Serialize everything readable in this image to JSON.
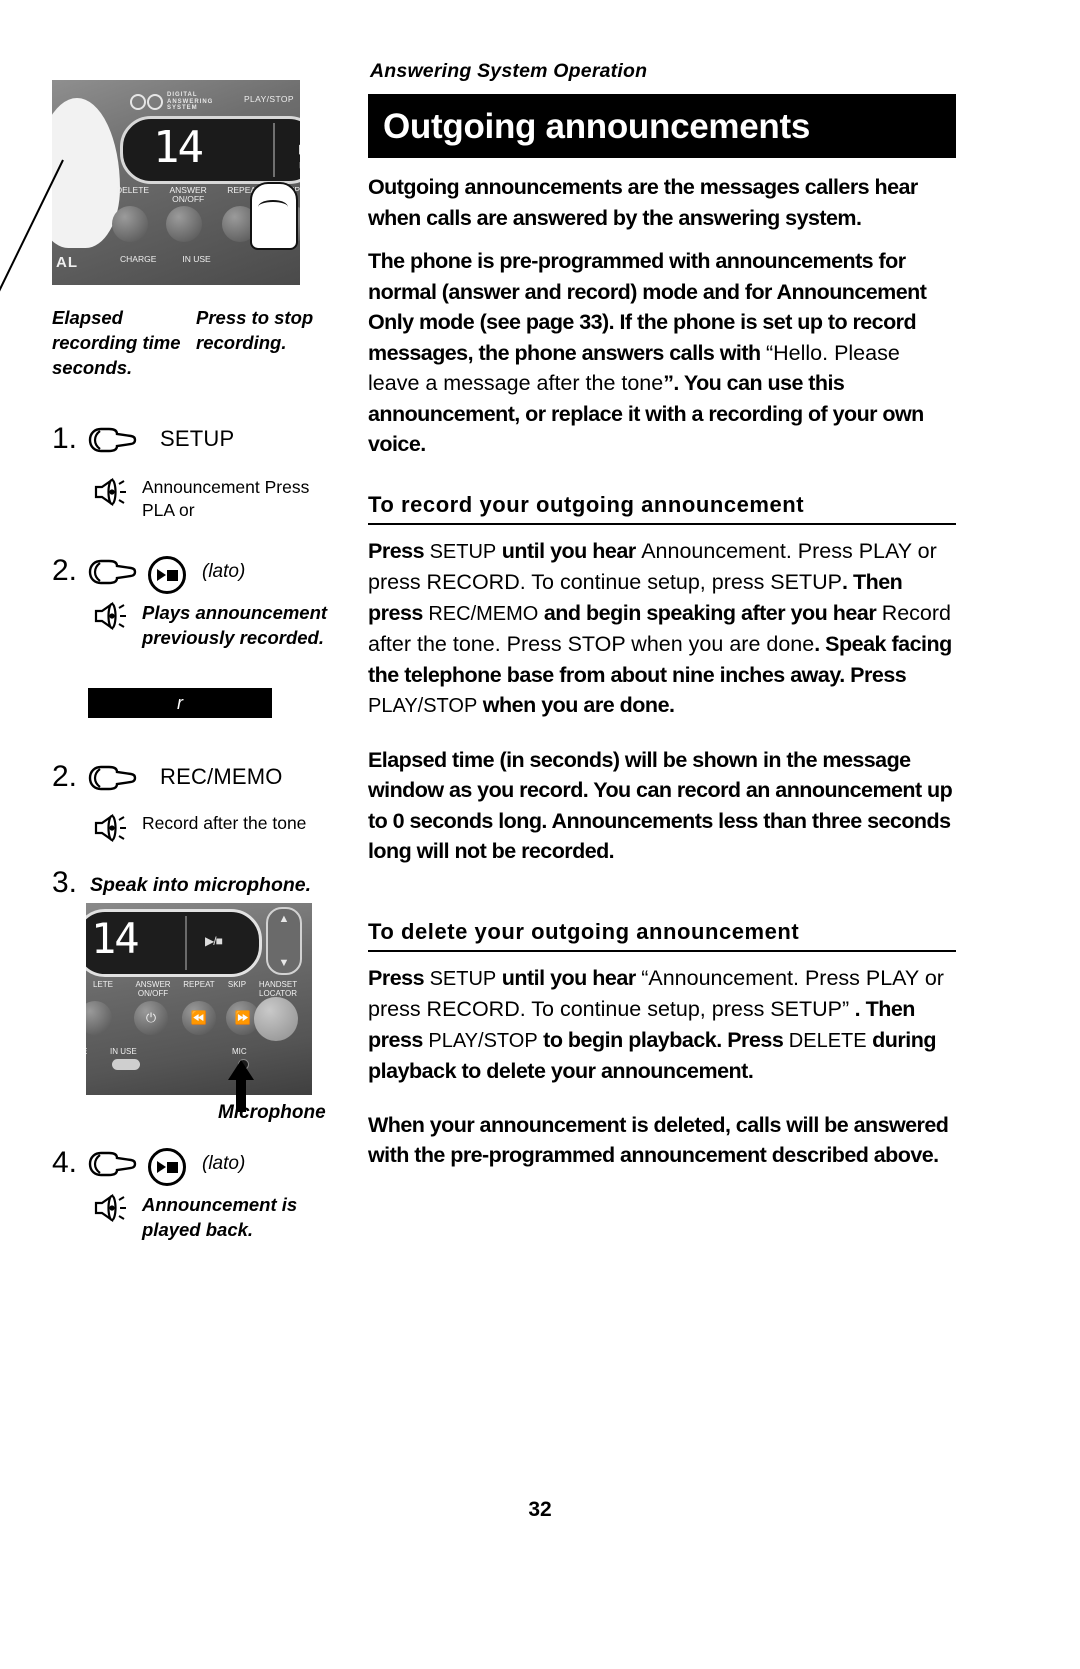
{
  "running_head": "Answering System Operation",
  "banner_title": "Outgoing announcements",
  "page_number": "32",
  "intro": {
    "p1": "Outgoing announcements are the messages callers hear when calls are answered by the answering system.",
    "p2_a": "The phone is pre-programmed with announcements for normal (answer and record) mode and for Announcement Only mode (see page 33). If the phone is set up to record messages, the phone answers calls with ",
    "p2_quote": "“Hello. Please leave a message after the tone",
    "p2_close": "”.",
    "p2_b": " You can use this announcement, or replace it with a recording of your own voice."
  },
  "record_section": {
    "heading": "To record your outgoing announcement",
    "line1_bold": "Press",
    "line1_key": "SETUP",
    "line1_bold2": "until you hear",
    "line1_reg": "Announcement. Press PLAY or press RECORD. To continue setup, press SETUP",
    "line2_bold": ". Then press",
    "line2_key": "REC/MEMO",
    "line2_bold2": "and begin speaking after you hear",
    "line2_reg": "Record after the tone. Press STOP when you are done",
    "line3_bold": ". Speak facing the telephone base from about nine inches away. Press",
    "line3_key": "PLAY/STOP",
    "line3_bold2": "when you are done.",
    "p_elapsed": "Elapsed time (in seconds) will be shown in the message window as you record. You can record an announcement up to 0 seconds long. Announcements less than three seconds long will not be recorded."
  },
  "delete_section": {
    "heading": "To delete your outgoing announcement",
    "line1_bold": "Press",
    "line1_key": "SETUP",
    "line1_bold2": "until you hear",
    "line1_reg": "“Announcement. Press PLAY or press RECORD. To continue setup, press SETUP”",
    "line2_bold": ". Then press",
    "line2_key": "PLAY/STOP",
    "line2_bold2": "to begin playback.",
    "line3_bold": "Press",
    "line3_key": "DELETE",
    "line3_bold2": "during playback to delete your announcement.",
    "p_when": "When your announcement is deleted, calls will be answered with the pre-programmed announcement described above."
  },
  "callouts": {
    "elapsed": "Elapsed recording time seconds.",
    "press_stop": "Press to stop recording."
  },
  "phone_top": {
    "logo_line1": "DIGITAL",
    "logo_line2": "ANSWERING",
    "logo_line3": "SYSTEM",
    "play_stop": "PLAY/STOP",
    "display": "14",
    "play_stop_icon": "▶/■",
    "labels": [
      "DELETE",
      "ANSWER ON/OFF",
      "REPEAT",
      "SKIP"
    ],
    "bottom_labels": [
      "CHARGE",
      "IN USE"
    ],
    "brand": "AL"
  },
  "phone_bottom": {
    "display": "14",
    "play_stop_icon": "▶/■",
    "labels": [
      "LETE",
      "ANSWER ON/OFF",
      "REPEAT",
      "SKIP",
      "HANDSET LOCATOR"
    ],
    "bottom_labels": [
      "E",
      "IN USE",
      "MIC"
    ],
    "mic_callout": "Microphone",
    "vol_up": "▲",
    "vol_down": "▼"
  },
  "steps": [
    {
      "num": "1.",
      "key_label": "SETUP",
      "note": "Announcement Press PLA or",
      "note_style": "regular"
    },
    {
      "num": "2.",
      "key_label": "",
      "paren": "(lato)",
      "note": "Plays announcement previously recorded.",
      "note_style": "bold-italic"
    },
    {
      "num": "2.",
      "key_label": "REC/MEMO",
      "note": "Record after the tone",
      "note_style": "regular"
    },
    {
      "num": "3.",
      "title": "Speak into microphone."
    },
    {
      "num": "4.",
      "key_label": "",
      "paren": "(lato)",
      "note": "Announcement is played back.",
      "note_style": "bold-italic"
    }
  ],
  "strip_text": "r",
  "icons": {
    "hand": "pointing-hand-icon",
    "speaker": "speaker-icon",
    "play_stop": "play-stop-button-icon"
  }
}
